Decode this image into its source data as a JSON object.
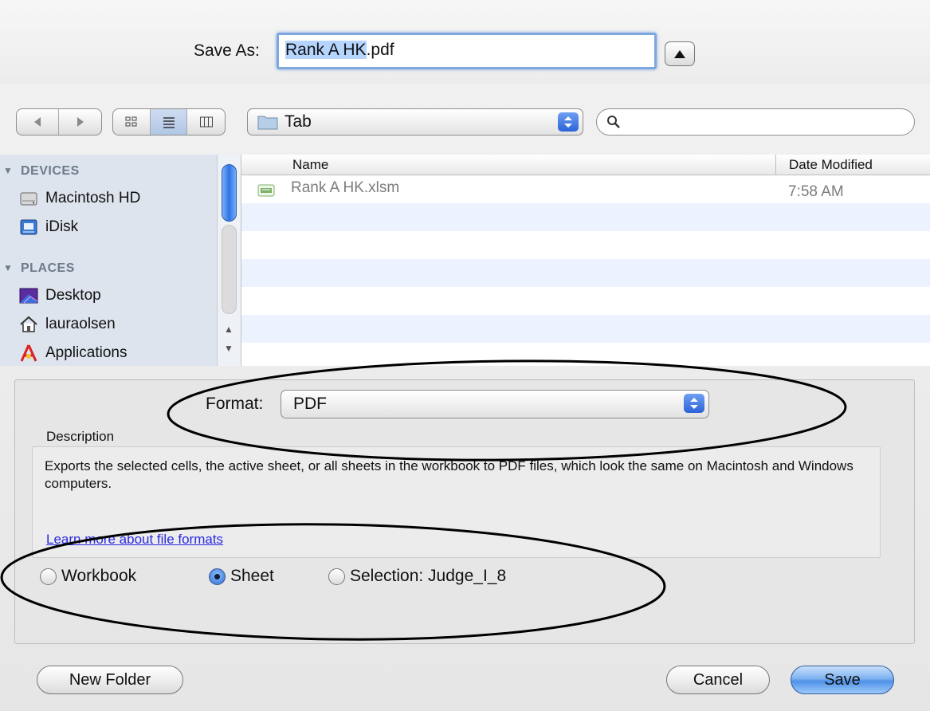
{
  "save_as": {
    "label": "Save As:",
    "filename_selected": "Rank A HK",
    "filename_ext": ".pdf"
  },
  "toolbar": {
    "location": "Tab",
    "search_placeholder": ""
  },
  "sidebar": {
    "devices_heading": "DEVICES",
    "devices": [
      {
        "label": "Macintosh HD",
        "icon": "hard-drive-icon"
      },
      {
        "label": "iDisk",
        "icon": "idisk-icon"
      }
    ],
    "places_heading": "PLACES",
    "places": [
      {
        "label": "Desktop",
        "icon": "desktop-icon"
      },
      {
        "label": "lauraolsen",
        "icon": "home-icon"
      },
      {
        "label": "Applications",
        "icon": "applications-icon"
      }
    ]
  },
  "file_list": {
    "columns": [
      "Name",
      "Date Modified"
    ],
    "rows": [
      {
        "name": "Rank A HK.xlsm",
        "date": "7:58 AM",
        "icon": "excel-file-icon"
      }
    ]
  },
  "format": {
    "label": "Format:",
    "value": "PDF"
  },
  "description": {
    "label": "Description",
    "text": "Exports the selected cells, the active sheet, or all sheets in the workbook to PDF files, which look the same on Macintosh and Windows computers.",
    "link": "Learn more about file formats"
  },
  "scope_options": [
    {
      "label": "Workbook",
      "selected": false
    },
    {
      "label": "Sheet",
      "selected": true
    },
    {
      "label": "Selection: Judge_I_8",
      "selected": false
    }
  ],
  "buttons": {
    "new_folder": "New Folder",
    "cancel": "Cancel",
    "save": "Save"
  },
  "colors": {
    "accent": "#2f6ed8",
    "sidebar_bg": "#dde4ed",
    "link": "#2a2ae0"
  }
}
